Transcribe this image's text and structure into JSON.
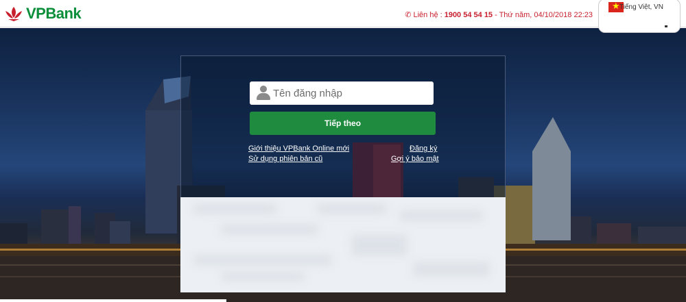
{
  "brand": {
    "name": "VPBank",
    "color": "#0b8e3a",
    "logo_color": "#c8202f",
    "icon": "lotus-logo-icon"
  },
  "header": {
    "contact_label": "Liên hệ :",
    "hotline": "1900 54 54 15",
    "datetime": "- Thứ năm, 04/10/2018 22:23",
    "phone_icon": "phone-icon"
  },
  "language": {
    "label": "Tiếng Việt, VN",
    "flag_icon": "vietnam-flag-icon"
  },
  "login": {
    "username_placeholder": "Tên đăng nhập",
    "next_label": "Tiếp theo",
    "button_color": "#1f8b3f"
  },
  "links": {
    "intro": "Giới thiệu VPBank Online mới",
    "old_version": "Sử dụng phiên bản cũ",
    "register": "Đăng ký",
    "security_tips": "Gợi ý bảo mật"
  }
}
